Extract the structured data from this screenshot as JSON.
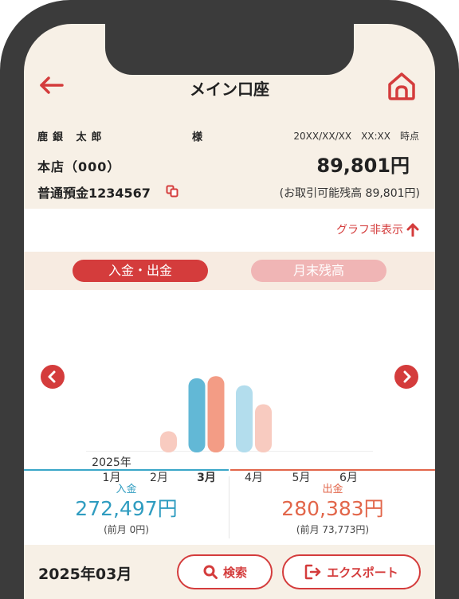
{
  "header": {
    "title": "メイン口座"
  },
  "account": {
    "holder": "鹿銀 太郎",
    "honorific": "様",
    "datetime": "20XX/XX/XX　XX:XX　時点",
    "branch": "本店（000）",
    "balance": "89,801円",
    "account_number": "普通預金1234567",
    "available": "(お取引可能残高 89,801円)"
  },
  "graph_toggle": {
    "label": "グラフ非表示"
  },
  "tabs": [
    {
      "label": "入金・出金",
      "active": true
    },
    {
      "label": "月末残高",
      "active": false
    }
  ],
  "chart_data": {
    "type": "bar",
    "year_label": "2025年",
    "categories": [
      "1月",
      "2月",
      "3月",
      "4月",
      "5月",
      "6月"
    ],
    "selected": "3月",
    "series": [
      {
        "name": "入金",
        "color": "#62b8d6",
        "values": [
          0,
          0,
          272497,
          246000,
          0,
          0
        ]
      },
      {
        "name": "出金",
        "color": "#f39c85",
        "values": [
          0,
          73773,
          280383,
          175000,
          0,
          0
        ]
      }
    ],
    "ylim": [
      0,
      290000
    ]
  },
  "summary": {
    "income": {
      "label": "入金",
      "value": "272,497円",
      "prev": "(前月 0円)"
    },
    "expense": {
      "label": "出金",
      "value": "280,383円",
      "prev": "(前月 73,773円)"
    }
  },
  "footer": {
    "month": "2025年03月",
    "search_label": "検索",
    "export_label": "エクスポート"
  }
}
